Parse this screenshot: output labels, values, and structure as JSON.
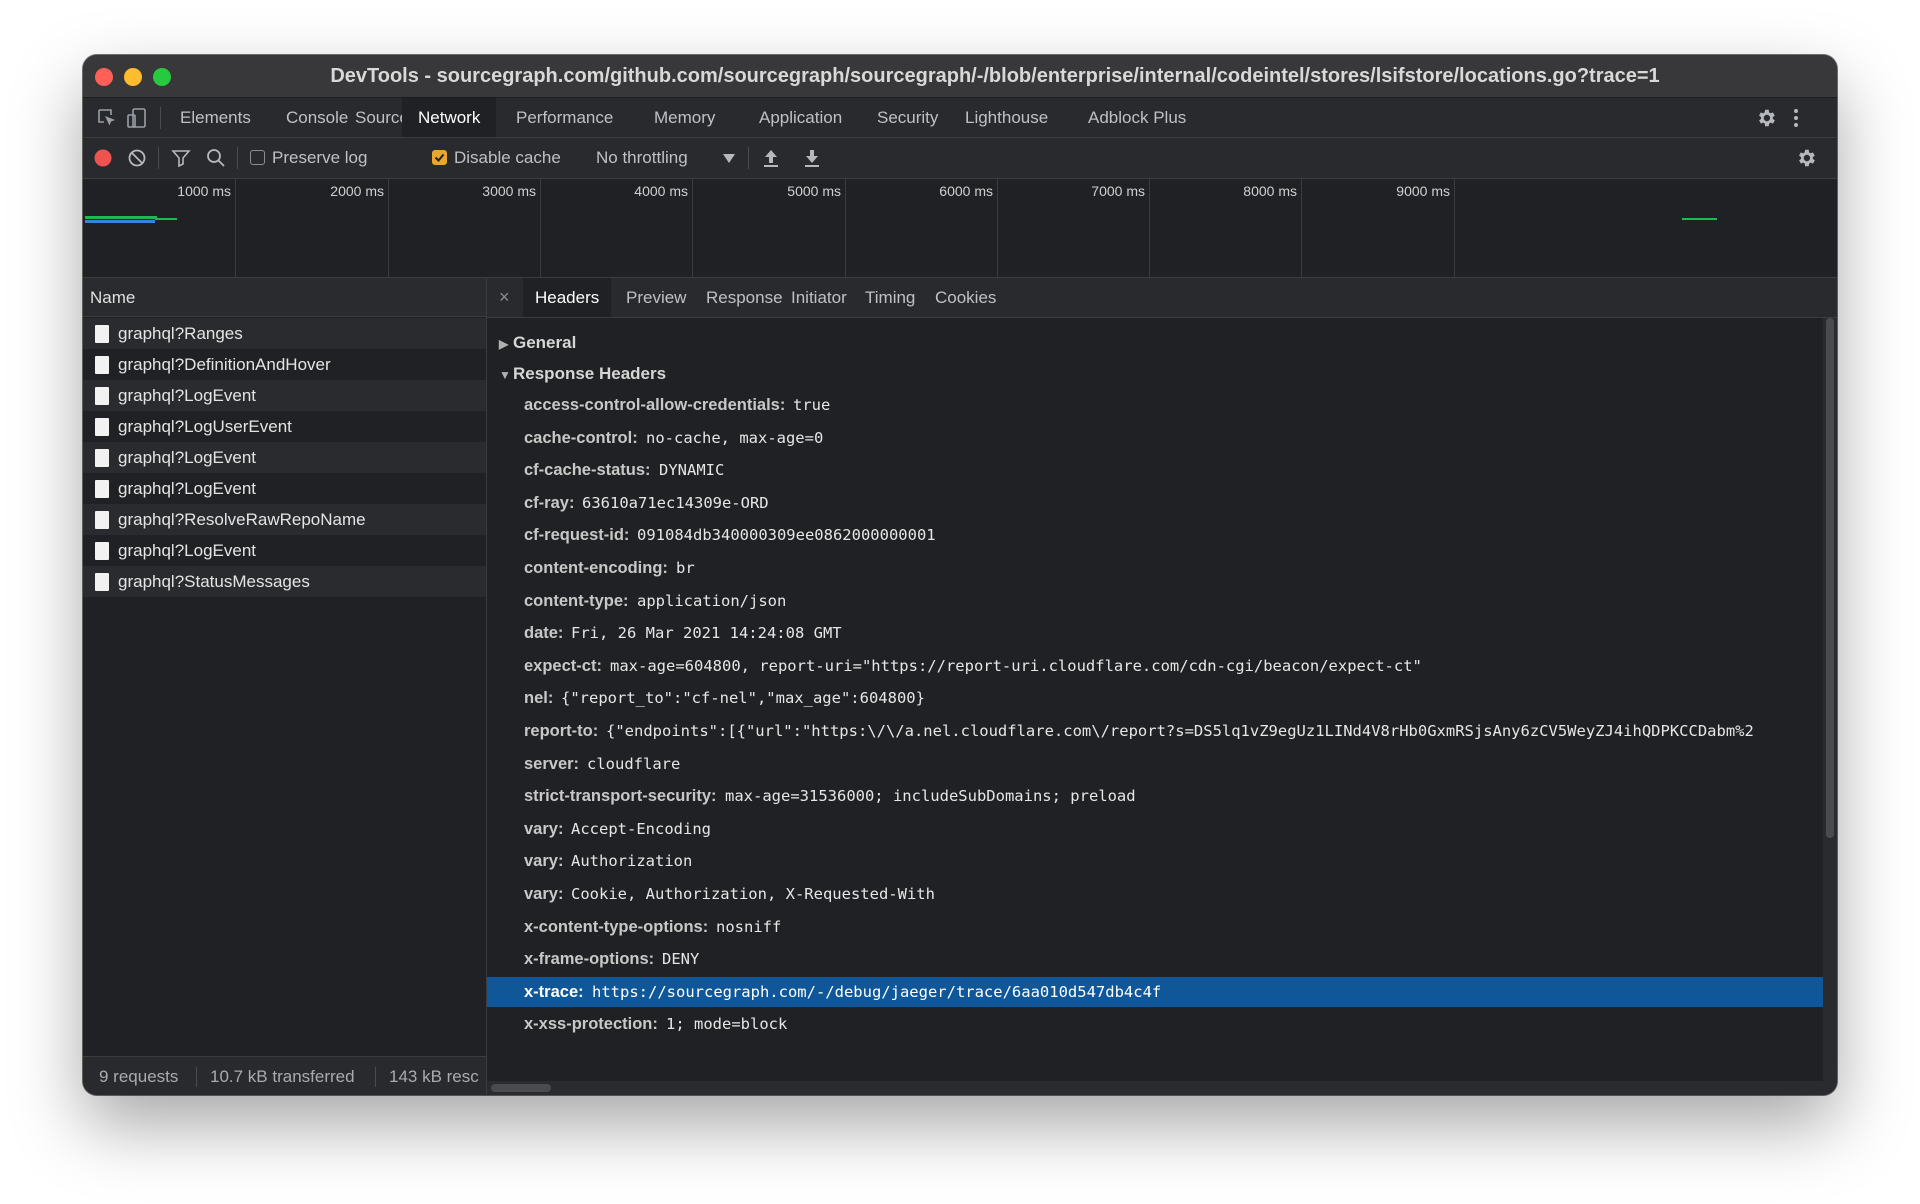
{
  "window": {
    "title": "DevTools - sourcegraph.com/github.com/sourcegraph/sourcegraph/-/blob/enterprise/internal/codeintel/stores/lsifstore/locations.go?trace=1"
  },
  "main_tabs": [
    "Elements",
    "Console",
    "Sources",
    "Network",
    "Performance",
    "Memory",
    "Application",
    "Security",
    "Lighthouse",
    "Adblock Plus"
  ],
  "active_main_tab": "Network",
  "toolbar": {
    "preserve_log_label": "Preserve log",
    "preserve_log_checked": false,
    "disable_cache_label": "Disable cache",
    "disable_cache_checked": true,
    "throttling_value": "No throttling"
  },
  "overview": {
    "ticks": [
      "1000 ms",
      "2000 ms",
      "3000 ms",
      "4000 ms",
      "5000 ms",
      "6000 ms",
      "7000 ms",
      "8000 ms",
      "9000 ms"
    ]
  },
  "request_list": {
    "header": "Name",
    "rows": [
      "graphql?Ranges",
      "graphql?DefinitionAndHover",
      "graphql?LogEvent",
      "graphql?LogUserEvent",
      "graphql?LogEvent",
      "graphql?LogEvent",
      "graphql?ResolveRawRepoName",
      "graphql?LogEvent",
      "graphql?StatusMessages"
    ],
    "status": {
      "requests": "9 requests",
      "transferred": "10.7 kB transferred",
      "resources": "143 kB resc"
    }
  },
  "detail": {
    "tabs": [
      "Headers",
      "Preview",
      "Response",
      "Initiator",
      "Timing",
      "Cookies"
    ],
    "active_tab": "Headers",
    "close_glyph": "×",
    "general_label": "General",
    "response_headers_label": "Response Headers",
    "headers": [
      {
        "k": "access-control-allow-credentials:",
        "v": "true"
      },
      {
        "k": "cache-control:",
        "v": "no-cache, max-age=0"
      },
      {
        "k": "cf-cache-status:",
        "v": "DYNAMIC"
      },
      {
        "k": "cf-ray:",
        "v": "63610a71ec14309e-ORD"
      },
      {
        "k": "cf-request-id:",
        "v": "091084db340000309ee0862000000001"
      },
      {
        "k": "content-encoding:",
        "v": "br"
      },
      {
        "k": "content-type:",
        "v": "application/json"
      },
      {
        "k": "date:",
        "v": "Fri, 26 Mar 2021 14:24:08 GMT"
      },
      {
        "k": "expect-ct:",
        "v": "max-age=604800, report-uri=\"https://report-uri.cloudflare.com/cdn-cgi/beacon/expect-ct\""
      },
      {
        "k": "nel:",
        "v": "{\"report_to\":\"cf-nel\",\"max_age\":604800}"
      },
      {
        "k": "report-to:",
        "v": "{\"endpoints\":[{\"url\":\"https:\\/\\/a.nel.cloudflare.com\\/report?s=DS5lq1vZ9egUz1LINd4V8rHb0GxmRSjsAny6zCV5WeyZJ4ihQDPKCCDabm%2"
      },
      {
        "k": "server:",
        "v": "cloudflare"
      },
      {
        "k": "strict-transport-security:",
        "v": "max-age=31536000; includeSubDomains; preload"
      },
      {
        "k": "vary:",
        "v": "Accept-Encoding"
      },
      {
        "k": "vary:",
        "v": "Authorization"
      },
      {
        "k": "vary:",
        "v": "Cookie, Authorization, X-Requested-With"
      },
      {
        "k": "x-content-type-options:",
        "v": "nosniff"
      },
      {
        "k": "x-frame-options:",
        "v": "DENY"
      },
      {
        "k": "x-trace:",
        "v": "https://sourcegraph.com/-/debug/jaeger/trace/6aa010d547db4c4f"
      },
      {
        "k": "x-xss-protection:",
        "v": "1; mode=block"
      }
    ],
    "selected_header": "x-trace:"
  },
  "colors": {
    "record_button": "#ef5350",
    "checkbox_accent": "#e8a531",
    "selection": "#0f5799",
    "timeline_green": "#1db954",
    "timeline_blue": "#3c82dc"
  }
}
